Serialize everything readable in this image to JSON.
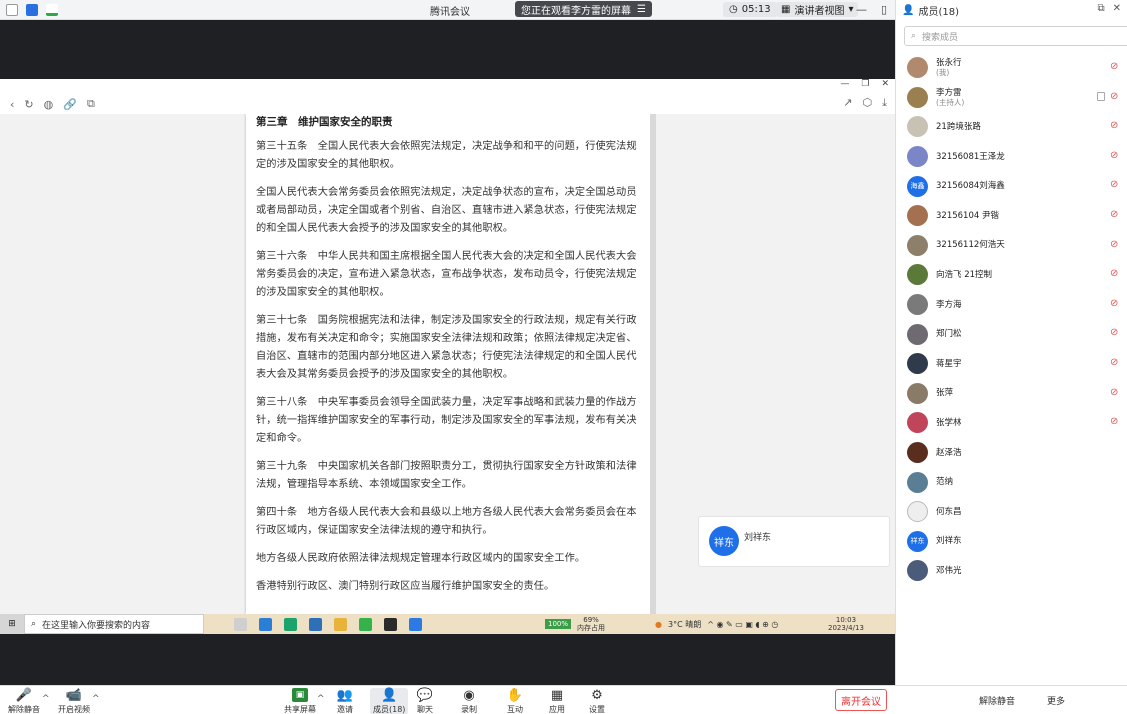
{
  "topbar": {
    "title": "腾讯会议",
    "share_notice": "您正在观看李方雷的屏幕",
    "timer": "05:13",
    "view_mode": "演讲者视图",
    "panel_title": "成员(18)"
  },
  "shared_doc": {
    "heading": "第三章　维护国家安全的职责",
    "paragraphs": [
      "第三十五条　全国人民代表大会依照宪法规定，决定战争和和平的问题，行使宪法规定的涉及国家安全的其他职权。",
      "全国人民代表大会常务委员会依照宪法规定，决定战争状态的宣布，决定全国总动员或者局部动员，决定全国或者个别省、自治区、直辖市进入紧急状态，行使宪法规定的和全国人民代表大会授予的涉及国家安全的其他职权。",
      "第三十六条　中华人民共和国主席根据全国人民代表大会的决定和全国人民代表大会常务委员会的决定，宣布进入紧急状态，宣布战争状态，发布动员令，行使宪法规定的涉及国家安全的其他职权。",
      "第三十七条　国务院根据宪法和法律，制定涉及国家安全的行政法规，规定有关行政措施，发布有关决定和命令；实施国家安全法律法规和政策；依照法律规定决定省、自治区、直辖市的范围内部分地区进入紧急状态；行使宪法法律规定的和全国人民代表大会及其常务委员会授予的涉及国家安全的其他职权。",
      "第三十八条　中央军事委员会领导全国武装力量，决定军事战略和武装力量的作战方针，统一指挥维护国家安全的军事行动，制定涉及国家安全的军事法规，发布有关决定和命令。",
      "第三十九条　中央国家机关各部门按照职责分工，贯彻执行国家安全方针政策和法律法规，管理指导本系统、本领域国家安全工作。",
      "第四十条　地方各级人民代表大会和县级以上地方各级人民代表大会常务委员会在本行政区域内，保证国家安全法律法规的遵守和执行。",
      "地方各级人民政府依照法律法规规定管理本行政区域内的国家安全工作。",
      "香港特别行政区、澳门特别行政区应当履行维护国家安全的责任。"
    ]
  },
  "speaker_card": {
    "avatar_text": "祥东",
    "name": "刘祥东"
  },
  "taskbar": {
    "search_placeholder": "在这里输入你要搜索的内容",
    "battery": "100%",
    "cpu_percent": "69%",
    "cpu_label": "内存占用",
    "weather": "3°C 晴朗",
    "time": "10:03",
    "date": "2023/4/13"
  },
  "panel": {
    "search_placeholder": "搜索成员",
    "members": [
      {
        "name": "张永行",
        "sub": "(我)",
        "avatar_color": "#b0896e",
        "avatar_text": "",
        "muted": true,
        "video": false
      },
      {
        "name": "李方雷",
        "sub": "(主持人)",
        "avatar_color": "#9a8050",
        "avatar_text": "",
        "muted": true,
        "video": true
      },
      {
        "name": "21跨境张路",
        "sub": "",
        "avatar_color": "#c8c2b4",
        "avatar_text": "",
        "muted": true,
        "video": false
      },
      {
        "name": "32156081王泽龙",
        "sub": "",
        "avatar_color": "#7b86c9",
        "avatar_text": "",
        "muted": true,
        "video": false
      },
      {
        "name": "32156084刘海鑫",
        "sub": "",
        "avatar_color": "#1f6fe8",
        "avatar_text": "海鑫",
        "muted": true,
        "video": false
      },
      {
        "name": "32156104 尹锴",
        "sub": "",
        "avatar_color": "#a3714f",
        "avatar_text": "",
        "muted": true,
        "video": false
      },
      {
        "name": "32156112何浩天",
        "sub": "",
        "avatar_color": "#8d7f69",
        "avatar_text": "",
        "muted": true,
        "video": false
      },
      {
        "name": "向浩飞 21控制",
        "sub": "",
        "avatar_color": "#5b7a3a",
        "avatar_text": "",
        "muted": true,
        "video": false
      },
      {
        "name": "李方海",
        "sub": "",
        "avatar_color": "#7a7a7a",
        "avatar_text": "",
        "muted": true,
        "video": false
      },
      {
        "name": "郑门松",
        "sub": "",
        "avatar_color": "#6f6a72",
        "avatar_text": "",
        "muted": true,
        "video": false
      },
      {
        "name": "蒋星宇",
        "sub": "",
        "avatar_color": "#2f3a4a",
        "avatar_text": "",
        "muted": true,
        "video": false
      },
      {
        "name": "张萍",
        "sub": "",
        "avatar_color": "#8a7a68",
        "avatar_text": "",
        "muted": true,
        "video": false
      },
      {
        "name": "张学林",
        "sub": "",
        "avatar_color": "#c0445a",
        "avatar_text": "",
        "muted": true,
        "video": false
      },
      {
        "name": "赵泽浩",
        "sub": "",
        "avatar_color": "#5a2e1e",
        "avatar_text": "",
        "muted": false,
        "video": false
      },
      {
        "name": "范纳",
        "sub": "",
        "avatar_color": "#5a7f94",
        "avatar_text": "",
        "muted": false,
        "video": false
      },
      {
        "name": "何东昌",
        "sub": "",
        "avatar_color": "#eeeeee",
        "avatar_text": "",
        "muted": false,
        "video": false
      },
      {
        "name": "刘祥东",
        "sub": "",
        "avatar_color": "#1f6fe8",
        "avatar_text": "祥东",
        "muted": false,
        "video": false
      },
      {
        "name": "邓伟光",
        "sub": "",
        "avatar_color": "#4b5c7a",
        "avatar_text": "",
        "muted": false,
        "video": false
      }
    ],
    "unmute_all": "解除静音",
    "more": "更多"
  },
  "bottombar": {
    "mute": "解除静音",
    "video": "开启视频",
    "share": "共享屏幕",
    "invite": "邀请",
    "members": "成员(18)",
    "chat": "聊天",
    "record": "录制",
    "reactions": "互动",
    "apps": "应用",
    "settings": "设置",
    "leave": "离开会议"
  },
  "colors": {
    "accent": "#1f6fe8",
    "danger": "#e33333"
  }
}
